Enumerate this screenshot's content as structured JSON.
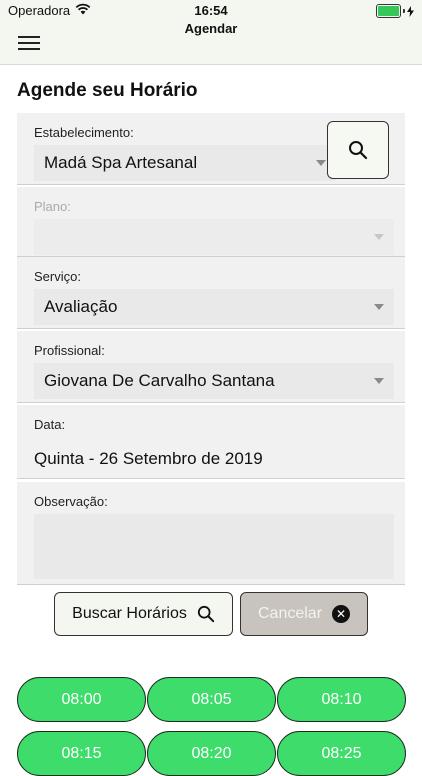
{
  "status_bar": {
    "carrier": "Operadora",
    "time": "16:54"
  },
  "nav": {
    "title": "Agendar"
  },
  "page": {
    "title": "Agende seu Horário"
  },
  "form": {
    "estabelecimento": {
      "label": "Estabelecimento:",
      "value": "Madá Spa Artesanal"
    },
    "plano": {
      "label": "Plano:",
      "value": ""
    },
    "servico": {
      "label": "Serviço:",
      "value": "Avaliação"
    },
    "profissional": {
      "label": "Profissional:",
      "value": "Giovana De Carvalho Santana"
    },
    "data": {
      "label": "Data:",
      "value": "Quinta - 26 Setembro de 2019"
    },
    "observacao": {
      "label": "Observação:",
      "value": ""
    }
  },
  "actions": {
    "search_label": "Buscar Horários",
    "cancel_label": "Cancelar"
  },
  "time_slots": [
    "08:00",
    "08:05",
    "08:10",
    "08:15",
    "08:20",
    "08:25"
  ],
  "colors": {
    "slot_green": "#3ddc6b",
    "nav_bg": "#f4f7ef",
    "cancel_bg": "#c8c3bd"
  }
}
